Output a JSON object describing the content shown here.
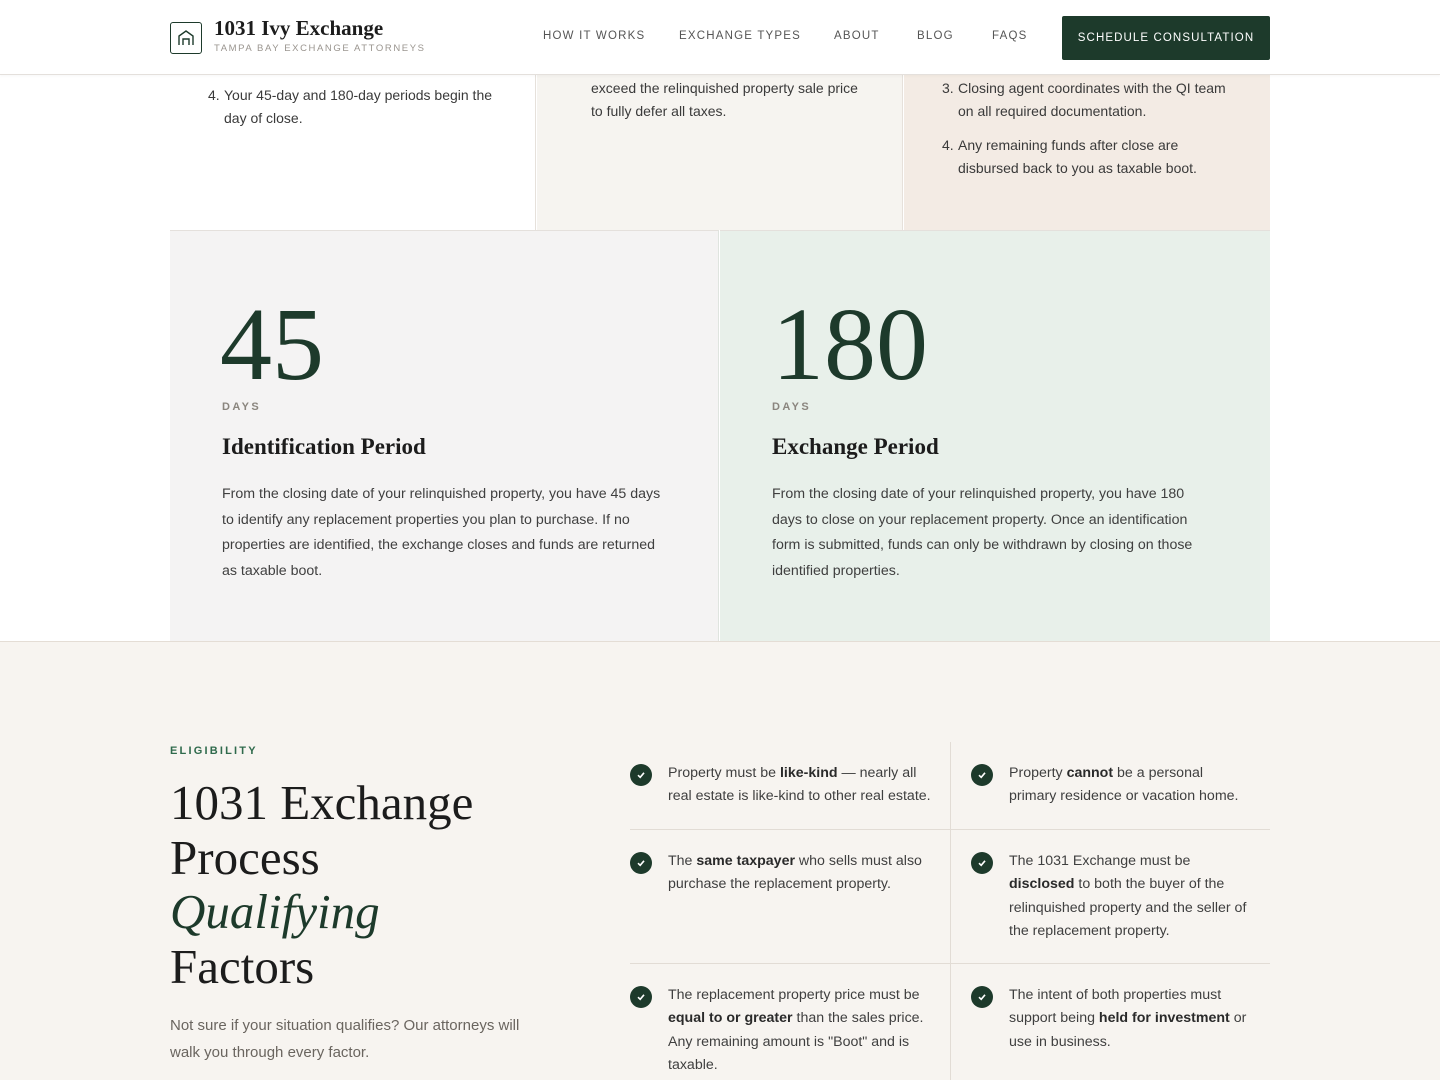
{
  "header": {
    "brand_name": "1031 Ivy Exchange",
    "brand_tagline": "TAMPA BAY EXCHANGE ATTORNEYS",
    "nav": [
      "HOW IT WORKS",
      "EXCHANGE TYPES",
      "ABOUT",
      "BLOG",
      "FAQS"
    ],
    "cta_label": "SCHEDULE CONSULTATION"
  },
  "steps": {
    "col1": {
      "items": [
        {
          "num": "4.",
          "text_lines": [
            "Your 45-day and 180-day periods begin the",
            "day of close."
          ]
        }
      ]
    },
    "col2": {
      "items": [
        {
          "num": "",
          "text_lines": [
            "exceed the relinquished property sale price",
            "to fully defer all taxes."
          ]
        }
      ]
    },
    "col3": {
      "items": [
        {
          "num": "3.",
          "text_lines": [
            "Closing agent coordinates with the QI team",
            "on all required documentation."
          ]
        },
        {
          "num": "4.",
          "text_lines": [
            "Any remaining funds after close are",
            "disbursed back to you as taxable boot."
          ]
        }
      ]
    }
  },
  "periods": [
    {
      "number": "45",
      "unit": "DAYS",
      "title": "Identification Period",
      "description": "From the closing date of your relinquished property, you have 45 days to identify any replacement properties you plan to purchase. If no properties are identified, the exchange closes and funds are returned as taxable boot."
    },
    {
      "number": "180",
      "unit": "DAYS",
      "title": "Exchange Period",
      "description": "From the closing date of your relinquished property, you have 180 days to close on your replacement property. Once an identification form is submitted, funds can only be withdrawn by closing on those identified properties."
    }
  ],
  "eligibility": {
    "eyebrow": "ELIGIBILITY",
    "heading_line1": "1031 Exchange",
    "heading_line2": "Process",
    "heading_line3_italic": "Qualifying",
    "heading_line4": "Factors",
    "lead": "Not sure if your situation qualifies? Our attorneys will walk you through every factor.",
    "factors": [
      {
        "pre": "Property must be ",
        "bold": "like-kind",
        "post": " — nearly all real estate is like-kind to other real estate."
      },
      {
        "pre": "Property ",
        "bold": "cannot",
        "post": " be a personal primary residence or vacation home."
      },
      {
        "pre": "The ",
        "bold": "same taxpayer",
        "post": " who sells must also purchase the replacement property."
      },
      {
        "pre": "The 1031 Exchange must be ",
        "bold": "disclosed",
        "post": " to both the buyer of the relinquished property and the seller of the replacement property."
      },
      {
        "pre": "The replacement property price must be ",
        "bold": "equal to or greater",
        "post": " than the sales price. Any remaining amount is \"Boot\" and is taxable."
      },
      {
        "pre": "The intent of both properties must support being ",
        "bold": "held for investment",
        "post": " or use in business."
      }
    ]
  },
  "colors": {
    "brand_green": "#1d3a2b",
    "card_gray": "#f4f3f3",
    "card_mint": "#e8f0ea",
    "card_cream": "#f6f4f0",
    "card_beige": "#f3ebe4",
    "section_bg": "#f7f4f0"
  }
}
